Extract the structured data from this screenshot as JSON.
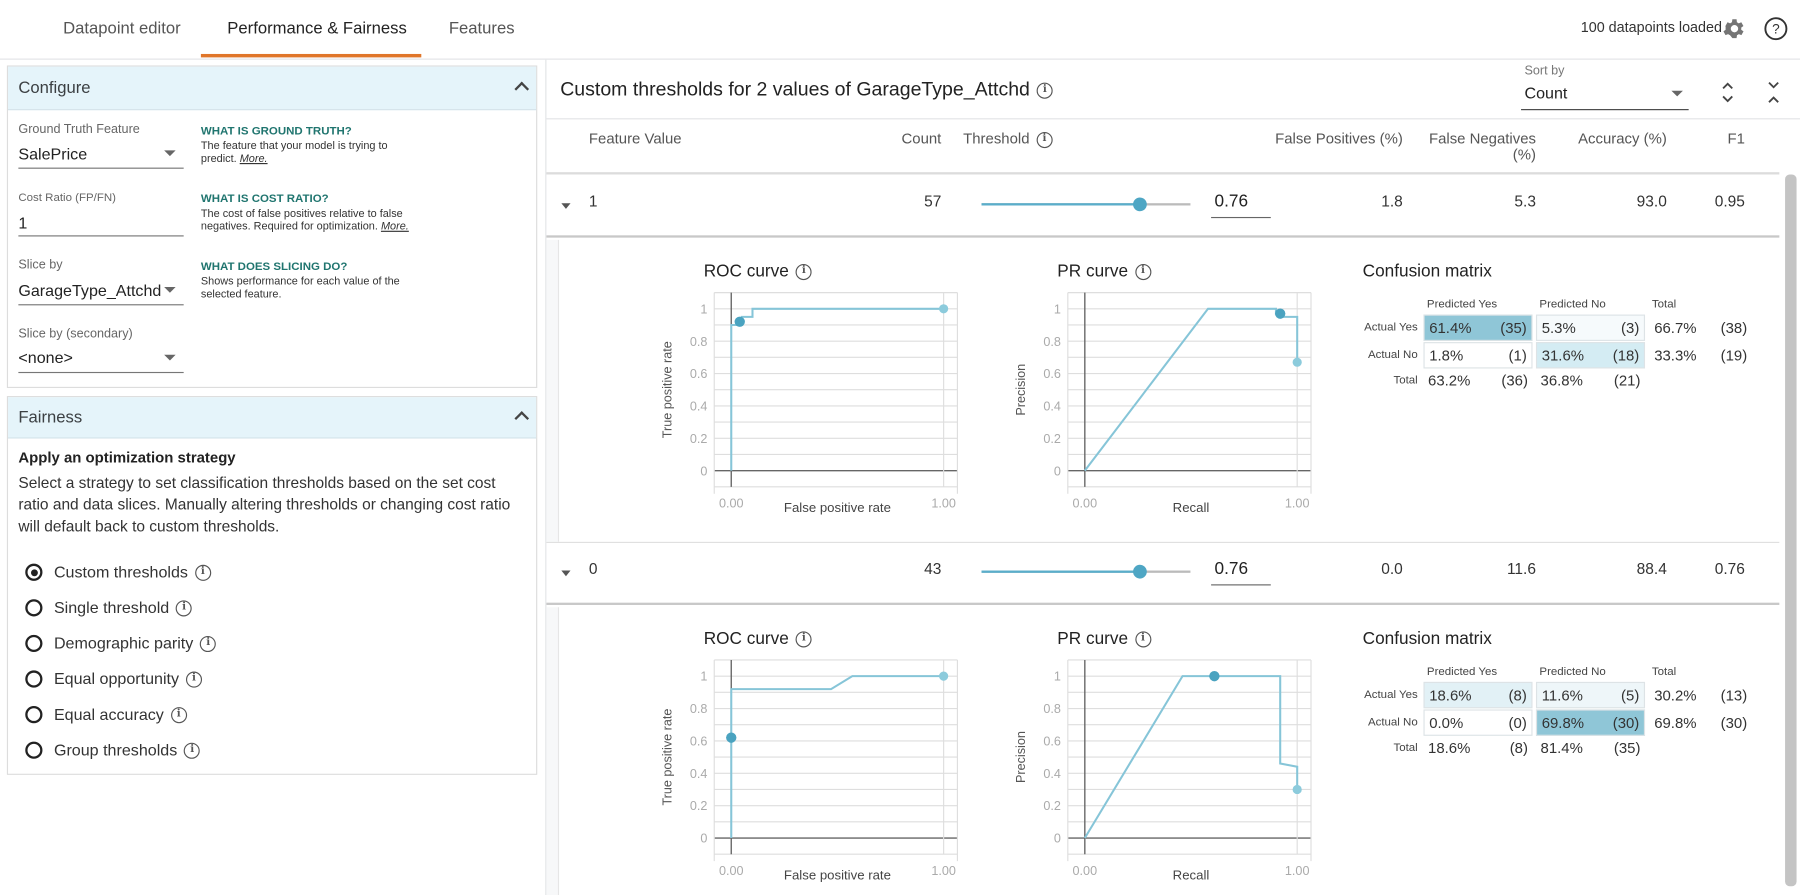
{
  "tabs": [
    {
      "label": "Datapoint editor",
      "active": false
    },
    {
      "label": "Performance & Fairness",
      "active": true
    },
    {
      "label": "Features",
      "active": false
    }
  ],
  "header": {
    "status": "100 datapoints loaded",
    "settings_icon": "gear-icon",
    "help_icon": "help-circle-icon"
  },
  "accent_color": "#e0762a",
  "configure": {
    "title": "Configure",
    "ground_truth": {
      "label": "Ground Truth Feature",
      "value": "SalePrice",
      "help_title": "WHAT IS GROUND TRUTH?",
      "help_text": "The feature that your model is trying to",
      "help_text2": "predict.",
      "more": "More."
    },
    "cost_ratio": {
      "label": "Cost Ratio (FP/FN)",
      "value": "1",
      "help_title": "WHAT IS COST RATIO?",
      "help_text": "The cost of false positives relative to false",
      "help_text2": "negatives. Required for optimization.",
      "more": "More."
    },
    "slice_by": {
      "label": "Slice by",
      "value": "GarageType_Attchd",
      "help_title": "WHAT DOES SLICING DO?",
      "help_text": "Shows performance for each value of the",
      "help_text2": "selected feature."
    },
    "slice_secondary": {
      "label": "Slice by (secondary)",
      "value": "<none>"
    }
  },
  "fairness": {
    "title": "Fairness",
    "heading": "Apply an optimization strategy",
    "description": "Select a strategy to set classification thresholds based on the set cost ratio and data slices. Manually altering thresholds or changing cost ratio will default back to custom thresholds.",
    "options": [
      {
        "label": "Custom thresholds",
        "selected": true
      },
      {
        "label": "Single threshold",
        "selected": false
      },
      {
        "label": "Demographic parity",
        "selected": false
      },
      {
        "label": "Equal opportunity",
        "selected": false
      },
      {
        "label": "Equal accuracy",
        "selected": false
      },
      {
        "label": "Group thresholds",
        "selected": false
      }
    ]
  },
  "main": {
    "title": "Custom thresholds for 2 values of GarageType_Attchd",
    "sort_by_label": "Sort by",
    "sort_by_value": "Count",
    "columns": [
      "Feature Value",
      "Count",
      "Threshold",
      "False Positives (%)",
      "False Negatives",
      "(%)",
      "Accuracy (%)",
      "F1"
    ],
    "rows": [
      {
        "feature_value": "1",
        "count": "57",
        "threshold": "0.76",
        "threshold_value": 0.76,
        "fp": "1.8",
        "fn": "5.3",
        "accuracy": "93.0",
        "f1": "0.95",
        "roc_title": "ROC curve",
        "pr_title": "PR curve",
        "cm_title": "Confusion matrix",
        "cm": {
          "headers": [
            "Predicted Yes",
            "Predicted No",
            "Total"
          ],
          "row_labels": [
            "Actual Yes",
            "Actual No",
            "Total"
          ],
          "cells": [
            [
              [
                "61.4%",
                "(35)"
              ],
              [
                "5.3%",
                "(3)"
              ],
              [
                "66.7%",
                "(38)"
              ]
            ],
            [
              [
                "1.8%",
                "(1)"
              ],
              [
                "31.6%",
                "(18)"
              ],
              [
                "33.3%",
                "(19)"
              ]
            ],
            [
              [
                "63.2%",
                "(36)"
              ],
              [
                "36.8%",
                "(21)"
              ]
            ]
          ],
          "cell_colors": [
            [
              "#8fc6d7",
              "#f6fafc"
            ],
            [
              "#ffffff",
              "#d4ecf3"
            ]
          ]
        }
      },
      {
        "feature_value": "0",
        "count": "43",
        "threshold": "0.76",
        "threshold_value": 0.76,
        "fp": "0.0",
        "fn": "11.6",
        "accuracy": "88.4",
        "f1": "0.76",
        "roc_title": "ROC curve",
        "pr_title": "PR curve",
        "cm_title": "Confusion matrix",
        "cm": {
          "headers": [
            "Predicted Yes",
            "Predicted No",
            "Total"
          ],
          "row_labels": [
            "Actual Yes",
            "Actual No",
            "Total"
          ],
          "cells": [
            [
              [
                "18.6%",
                "(8)"
              ],
              [
                "11.6%",
                "(5)"
              ],
              [
                "30.2%",
                "(13)"
              ]
            ],
            [
              [
                "0.0%",
                "(0)"
              ],
              [
                "69.8%",
                "(30)"
              ],
              [
                "69.8%",
                "(30)"
              ]
            ],
            [
              [
                "18.6%",
                "(8)"
              ],
              [
                "81.4%",
                "(35)"
              ]
            ]
          ],
          "cell_colors": [
            [
              "#e2f1f6",
              "#eef6f9"
            ],
            [
              "#ffffff",
              "#8fc6d7"
            ]
          ]
        }
      }
    ]
  },
  "chart_data": [
    {
      "type": "line",
      "title": "ROC curve",
      "xlabel": "False positive rate",
      "ylabel": "True positive rate",
      "xlim": [
        0,
        1
      ],
      "ylim": [
        0,
        1
      ],
      "xticks": [
        "0.00",
        "1.00"
      ],
      "yticks": [
        "0",
        "0.2",
        "0.4",
        "0.6",
        "0.8",
        "1"
      ],
      "grid": true,
      "points": [
        [
          0,
          0
        ],
        [
          0,
          0.9
        ],
        [
          0.05,
          0.9
        ],
        [
          0.05,
          0.95
        ],
        [
          0.1,
          0.95
        ],
        [
          0.1,
          1
        ],
        [
          1,
          1
        ]
      ],
      "markers": [
        {
          "x": 0.04,
          "y": 0.92,
          "kind": "threshold"
        },
        {
          "x": 1,
          "y": 1,
          "kind": "end"
        }
      ],
      "color": "#86c5d8"
    },
    {
      "type": "line",
      "title": "PR curve",
      "xlabel": "Recall",
      "ylabel": "Precision",
      "xlim": [
        0,
        1
      ],
      "ylim": [
        0,
        1
      ],
      "xticks": [
        "0.00",
        "1.00"
      ],
      "yticks": [
        "0",
        "0.2",
        "0.4",
        "0.6",
        "0.8",
        "1"
      ],
      "grid": true,
      "points": [
        [
          0,
          0
        ],
        [
          0.58,
          1
        ],
        [
          0.9,
          1
        ],
        [
          0.9,
          0.97
        ],
        [
          0.93,
          0.97
        ],
        [
          0.93,
          0.95
        ],
        [
          1,
          0.95
        ],
        [
          1,
          0.67
        ]
      ],
      "markers": [
        {
          "x": 0.92,
          "y": 0.97,
          "kind": "threshold"
        },
        {
          "x": 1,
          "y": 0.67,
          "kind": "end"
        }
      ],
      "color": "#86c5d8"
    },
    {
      "type": "line",
      "title": "ROC curve",
      "xlabel": "False positive rate",
      "ylabel": "True positive rate",
      "xlim": [
        0,
        1
      ],
      "ylim": [
        0,
        1
      ],
      "xticks": [
        "0.00",
        "1.00"
      ],
      "yticks": [
        "0",
        "0.2",
        "0.4",
        "0.6",
        "0.8",
        "1"
      ],
      "grid": true,
      "points": [
        [
          0,
          0
        ],
        [
          0,
          0.92
        ],
        [
          0.47,
          0.92
        ],
        [
          0.57,
          1
        ],
        [
          1,
          1
        ]
      ],
      "markers": [
        {
          "x": 0,
          "y": 0.62,
          "kind": "threshold"
        },
        {
          "x": 1,
          "y": 1,
          "kind": "end"
        }
      ],
      "color": "#86c5d8"
    },
    {
      "type": "line",
      "title": "PR curve",
      "xlabel": "Recall",
      "ylabel": "Precision",
      "xlim": [
        0,
        1
      ],
      "ylim": [
        0,
        1
      ],
      "xticks": [
        "0.00",
        "1.00"
      ],
      "yticks": [
        "0",
        "0.2",
        "0.4",
        "0.6",
        "0.8",
        "1"
      ],
      "grid": true,
      "points": [
        [
          0,
          0
        ],
        [
          0.46,
          1
        ],
        [
          0.92,
          1
        ],
        [
          0.92,
          0.46
        ],
        [
          1,
          0.44
        ],
        [
          1,
          0.3
        ]
      ],
      "markers": [
        {
          "x": 0.61,
          "y": 1,
          "kind": "threshold"
        },
        {
          "x": 1,
          "y": 0.3,
          "kind": "end"
        }
      ],
      "color": "#86c5d8"
    }
  ]
}
